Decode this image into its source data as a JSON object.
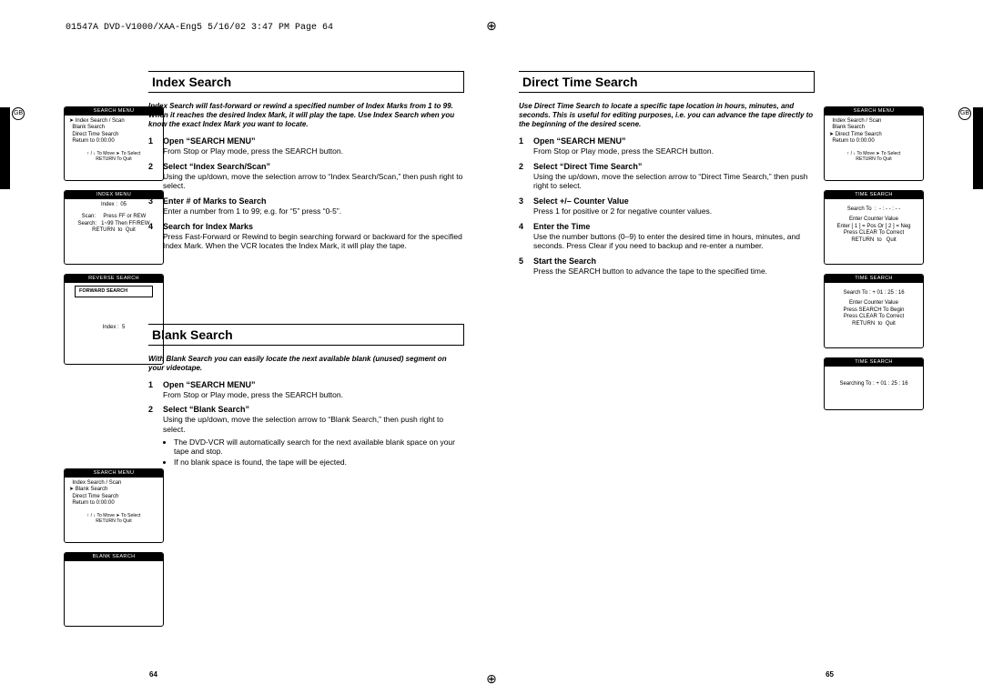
{
  "header_line": "01547A DVD-V1000/XAA-Eng5  5/16/02 3:47 PM  Page 64",
  "gb": "GB",
  "page_left_num": "64",
  "page_right_num": "65",
  "index": {
    "title": "Index Search",
    "intro": "Index Search will fast-forward or rewind a specified number of Index Marks from 1 to 99. When it reaches the desired Index Mark, it will play the tape. Use Index Search when you know the exact Index Mark you want to locate.",
    "s1t": "Open “SEARCH MENU”",
    "s1d": "From Stop or Play mode, press the SEARCH button.",
    "s2t": "Select “Index Search/Scan”",
    "s2d": "Using the up/down, move the selection arrow to “Index Search/Scan,” then push right to select.",
    "s3t": "Enter # of Marks to Search",
    "s3d": "Enter a number from 1 to 99; e.g. for “5” press “0-5”.",
    "s4t": "Search for Index Marks",
    "s4d": "Press Fast-Forward or Rewind to begin searching forward or backward for the specified Index Mark. When the VCR locates the Index Mark, it will play the tape.",
    "scr1_bar": "SEARCH MENU",
    "scr1_r1": "➤ Index Search / Scan",
    "scr1_r2": "  Blank Search",
    "scr1_r3": "  Direct Time Search",
    "scr1_r4": "  Return to 0:00:00",
    "scr1_f1": "↑ / ↓  To  Move        ➤  To Select",
    "scr1_f2": "RETURN To Quit",
    "scr2_bar": "INDEX MENU",
    "scr2_r1": "Index :  05",
    "scr2_r2": "Scan:     Press FF or REW",
    "scr2_r3": "Search:   1~99 Then FF/REW",
    "scr2_r4": "RETURN  to  Quit",
    "scr3_bar": "REVERSE SEARCH",
    "scr3_box": "FORWARD SEARCH",
    "scr3_r1": "Index :  5"
  },
  "blank": {
    "title": "Blank Search",
    "intro": "With Blank Search you can easily locate the next available blank (unused) segment on your videotape.",
    "s1t": "Open “SEARCH MENU”",
    "s1d": "From Stop or Play mode, press the SEARCH button.",
    "s2t": "Select “Blank Search”",
    "s2d": "Using the up/down, move the selection arrow to “Blank Search,” then push right to select.",
    "s2b1": "The DVD-VCR will automatically search for the next available blank space on your tape and stop.",
    "s2b2": "If no blank space is found, the tape will be ejected.",
    "scr1_bar": "SEARCH MENU",
    "scr1_r1": "  Index Search / Scan",
    "scr1_r2": "➤ Blank Search",
    "scr1_r3": "  Direct Time Search",
    "scr1_r4": "  Return to 0:00:00",
    "scr1_f1": "↑ / ↓  To  Move        ➤  To Select",
    "scr1_f2": "RETURN To Quit",
    "scr2_bar": "BLANK SEARCH"
  },
  "direct": {
    "title": "Direct Time Search",
    "intro": "Use Direct Time Search to locate a specific tape location in hours, minutes, and seconds. This is useful for editing purposes, i.e. you can advance the tape directly to the beginning of the desired scene.",
    "s1t": "Open “SEARCH MENU”",
    "s1d": "From Stop or Play mode, press the SEARCH button.",
    "s2t": "Select “Direct Time Search”",
    "s2d": "Using the up/down, move the selection arrow to “Direct Time Search,” then push right to select.",
    "s3t": "Select +/– Counter Value",
    "s3d": "Press 1 for positive or 2 for negative counter values.",
    "s4t": "Enter the Time",
    "s4d": "Use the number buttons (0–9) to enter the desired time in hours, minutes, and seconds. Press Clear if you need to backup and re-enter a number.",
    "s5t": "Start the Search",
    "s5d": "Press the SEARCH button to advance the tape to the specified time.",
    "scr1_bar": "SEARCH MENU",
    "scr1_r1": "  Index Search / Scan",
    "scr1_r2": "  Blank Search",
    "scr1_r3": "➤ Direct Time Search",
    "scr1_r4": "  Return to 0:00:00",
    "scr1_f1": "↑ / ↓  To  Move        ➤  To Select",
    "scr1_f2": "RETURN To Quit",
    "scr2_bar": "TIME SEARCH",
    "scr2_r1": "Search To  :  - : - - : - -",
    "scr2_r2": "Enter Counter Value",
    "scr2_r3": "Enter [ 1 ] = Pos Or [ 2 ] = Neg",
    "scr2_r4": "Press CLEAR To Correct",
    "scr2_r5": "RETURN  to   Quit",
    "scr3_bar": "TIME SEARCH",
    "scr3_r1": "Search To : + 01 : 25 : 16",
    "scr3_r2": "Enter Counter Value",
    "scr3_r3": "Press SEARCH To Begin",
    "scr3_r4": "Press CLEAR To Correct",
    "scr3_r5": "RETURN  to  Quit",
    "scr4_bar": "TIME SEARCH",
    "scr4_r1": "Searching To : + 01 : 25 : 16"
  }
}
